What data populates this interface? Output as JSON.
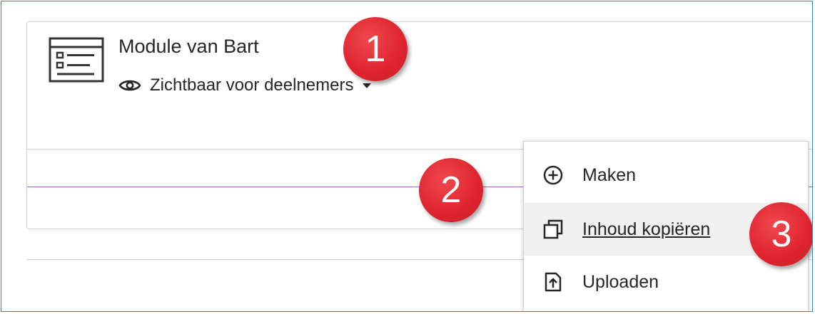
{
  "module": {
    "title": "Module van Bart",
    "visibility_label": "Zichtbaar voor deelnemers"
  },
  "menu": {
    "items": [
      {
        "label": "Maken",
        "icon": "plus-circle-icon"
      },
      {
        "label": "Inhoud kopiëren",
        "icon": "copy-icon"
      },
      {
        "label": "Uploaden",
        "icon": "upload-icon"
      }
    ]
  },
  "badges": {
    "one": "1",
    "two": "2",
    "three": "3"
  },
  "colors": {
    "insert_line": "#b25bd6",
    "badge": "#e02630",
    "frame_border": "#3b82b8"
  }
}
